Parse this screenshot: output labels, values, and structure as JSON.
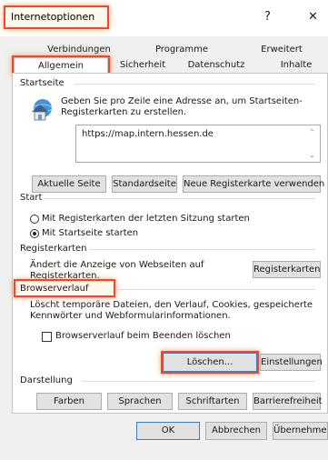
{
  "window": {
    "title": "Internetoptionen",
    "help_label": "?",
    "close_label": "✕"
  },
  "tabs": {
    "row1": [
      "Verbindungen",
      "Programme",
      "Erweitert"
    ],
    "row2": [
      "Allgemein",
      "Sicherheit",
      "Datenschutz",
      "Inhalte"
    ],
    "selected": "Allgemein"
  },
  "startseite": {
    "label": "Startseite",
    "description": "Geben Sie pro Zeile eine Adresse an, um Startseiten-Registerkarten zu erstellen.",
    "description_line1": "Geben Sie pro Zeile eine Adresse an, um Startseiten-",
    "description_line2": "Registerkarten zu erstellen.",
    "url": "https://map.intern.hessen.de",
    "buttons": [
      "Aktuelle Seite",
      "Standardseite",
      "Neue Registerkarte verwenden"
    ]
  },
  "start": {
    "label": "Start",
    "options": [
      {
        "label": "Mit Registerkarten der letzten Sitzung starten",
        "selected": false
      },
      {
        "label": "Mit Startseite starten",
        "selected": true
      }
    ]
  },
  "registerkarten": {
    "label": "Registerkarten",
    "description_line1": "Ändert die Anzeige von Webseiten auf",
    "description_line2": "Registerkarten.",
    "button": "Registerkarten"
  },
  "browserverlauf": {
    "label": "Browserverlauf",
    "description_line1": "Löscht temporäre Dateien, den Verlauf, Cookies, gespeicherte",
    "description_line2": "Kennwörter und Webformularinformationen.",
    "checkbox_label": "Browserverlauf beim Beenden löschen",
    "checkbox_checked": false,
    "delete_button": "Löschen...",
    "settings_button": "Einstellungen"
  },
  "darstellung": {
    "label": "Darstellung",
    "buttons": [
      "Farben",
      "Sprachen",
      "Schriftarten",
      "Barrierefreiheit"
    ]
  },
  "footer": {
    "ok": "OK",
    "cancel": "Abbrechen",
    "apply": "Übernehmen"
  },
  "colors": {
    "highlight": "#f2452f",
    "focus_border": "#3c7fb1"
  }
}
